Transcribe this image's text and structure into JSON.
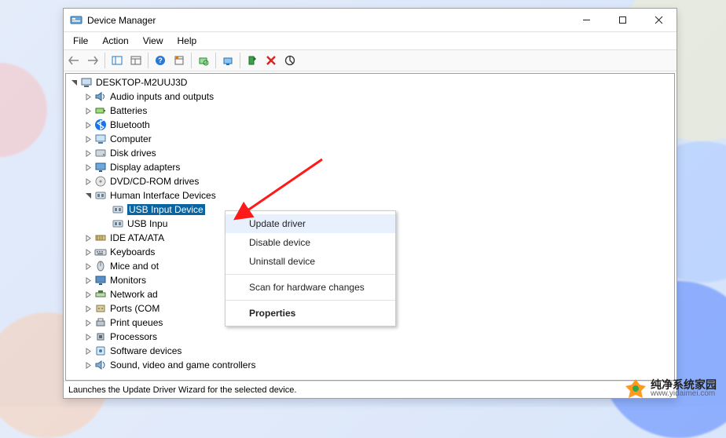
{
  "window": {
    "title": "Device Manager"
  },
  "menubar": [
    "File",
    "Action",
    "View",
    "Help"
  ],
  "tree": {
    "root": "DESKTOP-M2UUJ3D",
    "items": [
      {
        "label": "Audio inputs and outputs",
        "icon": "speaker"
      },
      {
        "label": "Batteries",
        "icon": "battery"
      },
      {
        "label": "Bluetooth",
        "icon": "bluetooth"
      },
      {
        "label": "Computer",
        "icon": "computer"
      },
      {
        "label": "Disk drives",
        "icon": "disk"
      },
      {
        "label": "Display adapters",
        "icon": "display"
      },
      {
        "label": "DVD/CD-ROM drives",
        "icon": "disc"
      },
      {
        "label": "Human Interface Devices",
        "icon": "hid",
        "expanded": true,
        "children": [
          {
            "label": "USB Input Device",
            "icon": "hid",
            "selected": true
          },
          {
            "label": "USB Input Device",
            "icon": "hid",
            "truncated": "USB Inpu"
          }
        ]
      },
      {
        "label": "IDE ATA/ATAPI controllers",
        "icon": "ide",
        "truncated": "IDE ATA/ATA"
      },
      {
        "label": "Keyboards",
        "icon": "keyboard"
      },
      {
        "label": "Mice and other pointing devices",
        "icon": "mouse",
        "truncated": "Mice and ot"
      },
      {
        "label": "Monitors",
        "icon": "monitor"
      },
      {
        "label": "Network adapters",
        "icon": "network",
        "truncated": "Network ad"
      },
      {
        "label": "Ports (COM & LPT)",
        "icon": "port",
        "truncated": "Ports (COM"
      },
      {
        "label": "Print queues",
        "icon": "printer"
      },
      {
        "label": "Processors",
        "icon": "cpu"
      },
      {
        "label": "Software devices",
        "icon": "software"
      },
      {
        "label": "Sound, video and game controllers",
        "icon": "sound"
      }
    ]
  },
  "context_menu": {
    "items": [
      {
        "label": "Update driver",
        "hover": true
      },
      {
        "label": "Disable device"
      },
      {
        "label": "Uninstall device"
      },
      {
        "sep": true
      },
      {
        "label": "Scan for hardware changes"
      },
      {
        "sep": true
      },
      {
        "label": "Properties",
        "bold": true
      }
    ]
  },
  "statusbar": "Launches the Update Driver Wizard for the selected device.",
  "watermark": {
    "title": "纯净系统家园",
    "url": "www.yidaimei.com"
  }
}
